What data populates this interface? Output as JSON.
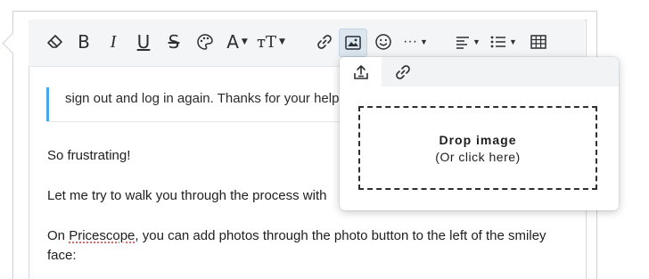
{
  "toolbar": {
    "buttons": [
      {
        "name": "remove-format",
        "icon": "eraser-icon"
      },
      {
        "name": "bold",
        "label": "B"
      },
      {
        "name": "italic",
        "label": "I"
      },
      {
        "name": "underline",
        "label": "U"
      },
      {
        "name": "strikethrough",
        "label": "S"
      },
      {
        "name": "text-color",
        "icon": "palette-icon"
      },
      {
        "name": "font-family",
        "label": "A"
      },
      {
        "name": "font-size",
        "label": "тT"
      },
      {
        "name": "insert-link",
        "icon": "link-icon"
      },
      {
        "name": "insert-image",
        "icon": "image-icon",
        "active": true
      },
      {
        "name": "insert-smiley",
        "icon": "smiley-icon"
      },
      {
        "name": "more-options",
        "label": "···"
      },
      {
        "name": "align",
        "icon": "align-left-icon"
      },
      {
        "name": "list",
        "icon": "list-icon"
      },
      {
        "name": "insert-table",
        "icon": "table-icon"
      }
    ]
  },
  "content": {
    "quote": "sign out and log in again. Thanks for your help",
    "line1": "So frustrating!",
    "line2": "Let me try to walk you through the process with",
    "line3_pre": "On ",
    "line3_misspelled": "Pricescope",
    "line3_post": ", you can add photos through the photo button to the left of the smiley",
    "line4": "face:"
  },
  "image_popup": {
    "tabs": [
      {
        "name": "upload",
        "icon": "upload-icon",
        "active": true
      },
      {
        "name": "by-url",
        "icon": "link-icon",
        "active": false
      }
    ],
    "drop_title": "Drop image",
    "drop_subtitle": "(Or click here)"
  },
  "colors": {
    "quote_accent": "#47a7eb",
    "active_button_bg": "#dbe6ef",
    "toolbar_bg": "#f4f5f6"
  }
}
